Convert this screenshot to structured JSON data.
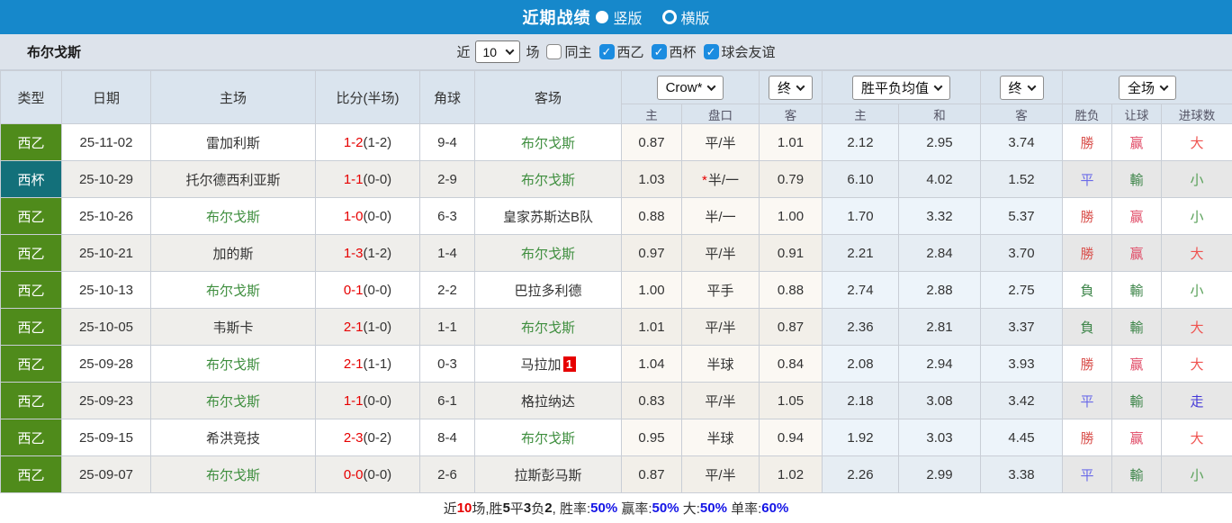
{
  "header": {
    "title": "近期战绩",
    "radio_vertical": "竖版",
    "radio_horizontal": "横版"
  },
  "filter": {
    "team": "布尔戈斯",
    "near_label": "近",
    "count_value": "10",
    "games_label": "场",
    "checkboxes": [
      {
        "label": "同主",
        "checked": false
      },
      {
        "label": "西乙",
        "checked": true
      },
      {
        "label": "西杯",
        "checked": true
      },
      {
        "label": "球会友谊",
        "checked": true
      }
    ]
  },
  "table": {
    "columns": [
      "类型",
      "日期",
      "主场",
      "比分(半场)",
      "角球",
      "客场"
    ],
    "selects": {
      "company": "Crow*",
      "company_time": "终",
      "avg": "胜平负均值",
      "avg_time": "终",
      "scope": "全场"
    },
    "sub_columns": [
      "主",
      "盘口",
      "客",
      "主",
      "和",
      "客",
      "胜负",
      "让球",
      "进球数"
    ],
    "rows": [
      {
        "league": "西乙",
        "league_type": "green",
        "date": "25-11-02",
        "home": "雷加利斯",
        "home_self": false,
        "home_card": "",
        "score": "1-2",
        "half": "(1-2)",
        "corner": "9-4",
        "away": "布尔戈斯",
        "away_self": true,
        "away_card": "",
        "crow_star": false,
        "crow": [
          "0.87",
          "平/半",
          "1.01"
        ],
        "avg": [
          "2.12",
          "2.95",
          "3.74"
        ],
        "results": [
          [
            "勝",
            "#d9534f"
          ],
          [
            "赢",
            "#e04a66"
          ],
          [
            "大",
            "#ef5350"
          ]
        ]
      },
      {
        "league": "西杯",
        "league_type": "teal",
        "date": "25-10-29",
        "home": "托尔德西利亚斯",
        "home_self": false,
        "home_card": "",
        "score": "1-1",
        "half": "(0-0)",
        "corner": "2-9",
        "away": "布尔戈斯",
        "away_self": true,
        "away_card": "",
        "crow_star": true,
        "crow": [
          "1.03",
          "半/一",
          "0.79"
        ],
        "avg": [
          "6.10",
          "4.02",
          "1.52"
        ],
        "results": [
          [
            "平",
            "#6a6ae8"
          ],
          [
            "輸",
            "#3d8549"
          ],
          [
            "小",
            "#58a058"
          ]
        ]
      },
      {
        "league": "西乙",
        "league_type": "green",
        "date": "25-10-26",
        "home": "布尔戈斯",
        "home_self": true,
        "home_card": "",
        "score": "1-0",
        "half": "(0-0)",
        "corner": "6-3",
        "away": "皇家苏斯达B队",
        "away_self": false,
        "away_card": "",
        "crow_star": false,
        "crow": [
          "0.88",
          "半/一",
          "1.00"
        ],
        "avg": [
          "1.70",
          "3.32",
          "5.37"
        ],
        "results": [
          [
            "勝",
            "#d9534f"
          ],
          [
            "赢",
            "#e04a66"
          ],
          [
            "小",
            "#58a058"
          ]
        ]
      },
      {
        "league": "西乙",
        "league_type": "green",
        "date": "25-10-21",
        "home": "加的斯",
        "home_self": false,
        "home_card": "",
        "score": "1-3",
        "half": "(1-2)",
        "corner": "1-4",
        "away": "布尔戈斯",
        "away_self": true,
        "away_card": "",
        "crow_star": false,
        "crow": [
          "0.97",
          "平/半",
          "0.91"
        ],
        "avg": [
          "2.21",
          "2.84",
          "3.70"
        ],
        "results": [
          [
            "勝",
            "#d9534f"
          ],
          [
            "赢",
            "#e04a66"
          ],
          [
            "大",
            "#ef5350"
          ]
        ]
      },
      {
        "league": "西乙",
        "league_type": "green",
        "date": "25-10-13",
        "home": "布尔戈斯",
        "home_self": true,
        "home_card": "",
        "score": "0-1",
        "half": "(0-0)",
        "corner": "2-2",
        "away": "巴拉多利德",
        "away_self": false,
        "away_card": "",
        "crow_star": false,
        "crow": [
          "1.00",
          "平手",
          "0.88"
        ],
        "avg": [
          "2.74",
          "2.88",
          "2.75"
        ],
        "results": [
          [
            "負",
            "#3d8549"
          ],
          [
            "輸",
            "#3d8549"
          ],
          [
            "小",
            "#58a058"
          ]
        ]
      },
      {
        "league": "西乙",
        "league_type": "green",
        "date": "25-10-05",
        "home": "韦斯卡",
        "home_self": false,
        "home_card": "",
        "score": "2-1",
        "half": "(1-0)",
        "corner": "1-1",
        "away": "布尔戈斯",
        "away_self": true,
        "away_card": "",
        "crow_star": false,
        "crow": [
          "1.01",
          "平/半",
          "0.87"
        ],
        "avg": [
          "2.36",
          "2.81",
          "3.37"
        ],
        "results": [
          [
            "負",
            "#3d8549"
          ],
          [
            "輸",
            "#3d8549"
          ],
          [
            "大",
            "#ef5350"
          ]
        ]
      },
      {
        "league": "西乙",
        "league_type": "green",
        "date": "25-09-28",
        "home": "布尔戈斯",
        "home_self": true,
        "home_card": "",
        "score": "2-1",
        "half": "(1-1)",
        "corner": "0-3",
        "away": "马拉加",
        "away_self": false,
        "away_card": "1",
        "crow_star": false,
        "crow": [
          "1.04",
          "半球",
          "0.84"
        ],
        "avg": [
          "2.08",
          "2.94",
          "3.93"
        ],
        "results": [
          [
            "勝",
            "#d9534f"
          ],
          [
            "赢",
            "#e04a66"
          ],
          [
            "大",
            "#ef5350"
          ]
        ]
      },
      {
        "league": "西乙",
        "league_type": "green",
        "date": "25-09-23",
        "home": "布尔戈斯",
        "home_self": true,
        "home_card": "",
        "score": "1-1",
        "half": "(0-0)",
        "corner": "6-1",
        "away": "格拉纳达",
        "away_self": false,
        "away_card": "",
        "crow_star": false,
        "crow": [
          "0.83",
          "平/半",
          "1.05"
        ],
        "avg": [
          "2.18",
          "3.08",
          "3.42"
        ],
        "results": [
          [
            "平",
            "#6a6ae8"
          ],
          [
            "輸",
            "#3d8549"
          ],
          [
            "走",
            "#4438d8"
          ]
        ]
      },
      {
        "league": "西乙",
        "league_type": "green",
        "date": "25-09-15",
        "home": "希洪竞技",
        "home_self": false,
        "home_card": "",
        "score": "2-3",
        "half": "(0-2)",
        "corner": "8-4",
        "away": "布尔戈斯",
        "away_self": true,
        "away_card": "",
        "crow_star": false,
        "crow": [
          "0.95",
          "半球",
          "0.94"
        ],
        "avg": [
          "1.92",
          "3.03",
          "4.45"
        ],
        "results": [
          [
            "勝",
            "#d9534f"
          ],
          [
            "赢",
            "#e04a66"
          ],
          [
            "大",
            "#ef5350"
          ]
        ]
      },
      {
        "league": "西乙",
        "league_type": "green",
        "date": "25-09-07",
        "home": "布尔戈斯",
        "home_self": true,
        "home_card": "",
        "score": "0-0",
        "half": "(0-0)",
        "corner": "2-6",
        "away": "拉斯彭马斯",
        "away_self": false,
        "away_card": "",
        "crow_star": false,
        "crow": [
          "0.87",
          "平/半",
          "1.02"
        ],
        "avg": [
          "2.26",
          "2.99",
          "3.38"
        ],
        "results": [
          [
            "平",
            "#6a6ae8"
          ],
          [
            "輸",
            "#3d8549"
          ],
          [
            "小",
            "#58a058"
          ]
        ]
      }
    ]
  },
  "footer": {
    "segments": [
      [
        "近",
        "#333333",
        false
      ],
      [
        "10",
        "#e60000",
        true
      ],
      [
        "场,胜",
        "#333333",
        false
      ],
      [
        "5",
        "#1b1b1b",
        true
      ],
      [
        "平",
        "#333333",
        false
      ],
      [
        "3",
        "#1b1b1b",
        true
      ],
      [
        "负",
        "#333333",
        false
      ],
      [
        "2",
        "#1b1b1b",
        true
      ],
      [
        ", 胜率:",
        "#333333",
        false
      ],
      [
        "50%",
        "#1414e6",
        true
      ],
      [
        " 赢率:",
        "#333333",
        false
      ],
      [
        "50%",
        "#1414e6",
        true
      ],
      [
        " 大:",
        "#333333",
        false
      ],
      [
        "50%",
        "#1414e6",
        true
      ],
      [
        " 单率:",
        "#333333",
        false
      ],
      [
        "60%",
        "#1414e6",
        true
      ]
    ]
  },
  "colors": {
    "topbar_blue": "#1688cb",
    "league_green": "#4f8b1b",
    "league_teal": "#13707a",
    "self_team_green": "#3e8e3e",
    "score_red": "#e60000",
    "win_red": "#d9534f",
    "handicap_win_red": "#e04a66",
    "big_red": "#ef5350",
    "draw_blue": "#6a6ae8",
    "lose_green": "#3d8549",
    "small_green": "#58a058",
    "push_blue": "#4438d8",
    "percent_blue": "#1414e6"
  }
}
